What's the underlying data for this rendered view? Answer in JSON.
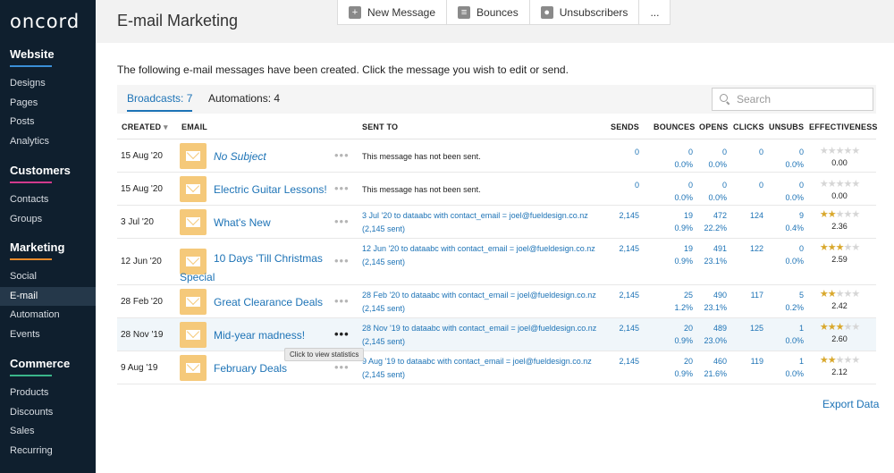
{
  "sidebar": {
    "logo": "oncord",
    "sections": [
      {
        "title": "Website",
        "accent": "#3a8fd6",
        "items": [
          {
            "label": "Designs"
          },
          {
            "label": "Pages"
          },
          {
            "label": "Posts"
          },
          {
            "label": "Analytics"
          }
        ]
      },
      {
        "title": "Customers",
        "accent": "#d23a8c",
        "items": [
          {
            "label": "Contacts"
          },
          {
            "label": "Groups"
          }
        ]
      },
      {
        "title": "Marketing",
        "accent": "#e88a2a",
        "items": [
          {
            "label": "Social"
          },
          {
            "label": "E-mail",
            "active": true
          },
          {
            "label": "Automation"
          },
          {
            "label": "Events"
          }
        ]
      },
      {
        "title": "Commerce",
        "accent": "#3ab58a",
        "items": [
          {
            "label": "Products"
          },
          {
            "label": "Discounts"
          },
          {
            "label": "Sales"
          },
          {
            "label": "Recurring"
          }
        ]
      }
    ]
  },
  "header": {
    "title": "E-mail Marketing",
    "toolbar": [
      {
        "label": "New Message",
        "icon": "plus-icon"
      },
      {
        "label": "Bounces",
        "icon": "bounce-icon"
      },
      {
        "label": "Unsubscribers",
        "icon": "user-icon"
      },
      {
        "label": "...",
        "icon": ""
      }
    ]
  },
  "intro": "The following e-mail messages have been created. Click the message you wish to edit or send.",
  "tabs": {
    "broadcasts": "Broadcasts: 7",
    "automations": "Automations: 4"
  },
  "search": {
    "placeholder": "Search"
  },
  "table": {
    "headers": {
      "created": "CREATED",
      "email": "EMAIL",
      "sent_to": "SENT TO",
      "sends": "SENDS",
      "bounces": "BOUNCES",
      "opens": "OPENS",
      "clicks": "CLICKS",
      "unsubs": "UNSUBS",
      "effectiveness": "EFFECTIVENESS"
    },
    "sort_indicator": "▾",
    "rows": [
      {
        "created": "15 Aug '20",
        "email": "No Subject",
        "italic": true,
        "sent_to": "This message has not been sent.",
        "sent_count": "",
        "sends": "0",
        "bounces": "0",
        "bounces_pct": "0.0%",
        "opens": "0",
        "opens_pct": "0.0%",
        "clicks": "0",
        "unsubs": "0",
        "unsubs_pct": "0.0%",
        "stars": 0,
        "effectiveness": "0.00"
      },
      {
        "created": "15 Aug '20",
        "email": "Electric Guitar Lessons!",
        "italic": false,
        "sent_to": "This message has not been sent.",
        "sent_count": "",
        "sends": "0",
        "bounces": "0",
        "bounces_pct": "0.0%",
        "opens": "0",
        "opens_pct": "0.0%",
        "clicks": "0",
        "unsubs": "0",
        "unsubs_pct": "0.0%",
        "stars": 0,
        "effectiveness": "0.00"
      },
      {
        "created": "3 Jul '20",
        "email": "What's New",
        "italic": false,
        "sent_to": "3 Jul '20 to dataabc with contact_email = joel@fueldesign.co.nz",
        "sent_count": "(2,145 sent)",
        "sends": "2,145",
        "bounces": "19",
        "bounces_pct": "0.9%",
        "opens": "472",
        "opens_pct": "22.2%",
        "clicks": "124",
        "unsubs": "9",
        "unsubs_pct": "0.4%",
        "stars": 2.36,
        "effectiveness": "2.36"
      },
      {
        "created": "12 Jun '20",
        "email": "10 Days 'Till Christmas Special",
        "italic": false,
        "sent_to": "12 Jun '20 to dataabc with contact_email = joel@fueldesign.co.nz",
        "sent_count": "(2,145 sent)",
        "sends": "2,145",
        "bounces": "19",
        "bounces_pct": "0.9%",
        "opens": "491",
        "opens_pct": "23.1%",
        "clicks": "122",
        "unsubs": "0",
        "unsubs_pct": "0.0%",
        "stars": 2.59,
        "effectiveness": "2.59"
      },
      {
        "created": "28 Feb '20",
        "email": "Great Clearance Deals",
        "italic": false,
        "sent_to": "28 Feb '20 to dataabc with contact_email = joel@fueldesign.co.nz",
        "sent_count": "(2,145 sent)",
        "sends": "2,145",
        "bounces": "25",
        "bounces_pct": "1.2%",
        "opens": "490",
        "opens_pct": "23.1%",
        "clicks": "117",
        "unsubs": "5",
        "unsubs_pct": "0.2%",
        "stars": 2.42,
        "effectiveness": "2.42"
      },
      {
        "created": "28 Nov '19",
        "email": "Mid-year madness!",
        "italic": false,
        "sent_to": "28 Nov '19 to dataabc with contact_email = joel@fueldesign.co.nz",
        "sent_count": "(2,145 sent)",
        "sends": "2,145",
        "bounces": "20",
        "bounces_pct": "0.9%",
        "opens": "489",
        "opens_pct": "23.0%",
        "clicks": "125",
        "unsubs": "1",
        "unsubs_pct": "0.0%",
        "stars": 2.6,
        "effectiveness": "2.60",
        "hovered": true
      },
      {
        "created": "9 Aug '19",
        "email": "February Deals",
        "italic": false,
        "sent_to": "9 Aug '19 to dataabc with contact_email = joel@fueldesign.co.nz",
        "sent_count": "(2,145 sent)",
        "sends": "2,145",
        "bounces": "20",
        "bounces_pct": "0.9%",
        "opens": "460",
        "opens_pct": "21.6%",
        "clicks": "119",
        "unsubs": "1",
        "unsubs_pct": "0.0%",
        "stars": 2.12,
        "effectiveness": "2.12"
      }
    ]
  },
  "tooltip": "Click to view statistics",
  "export": "Export Data"
}
